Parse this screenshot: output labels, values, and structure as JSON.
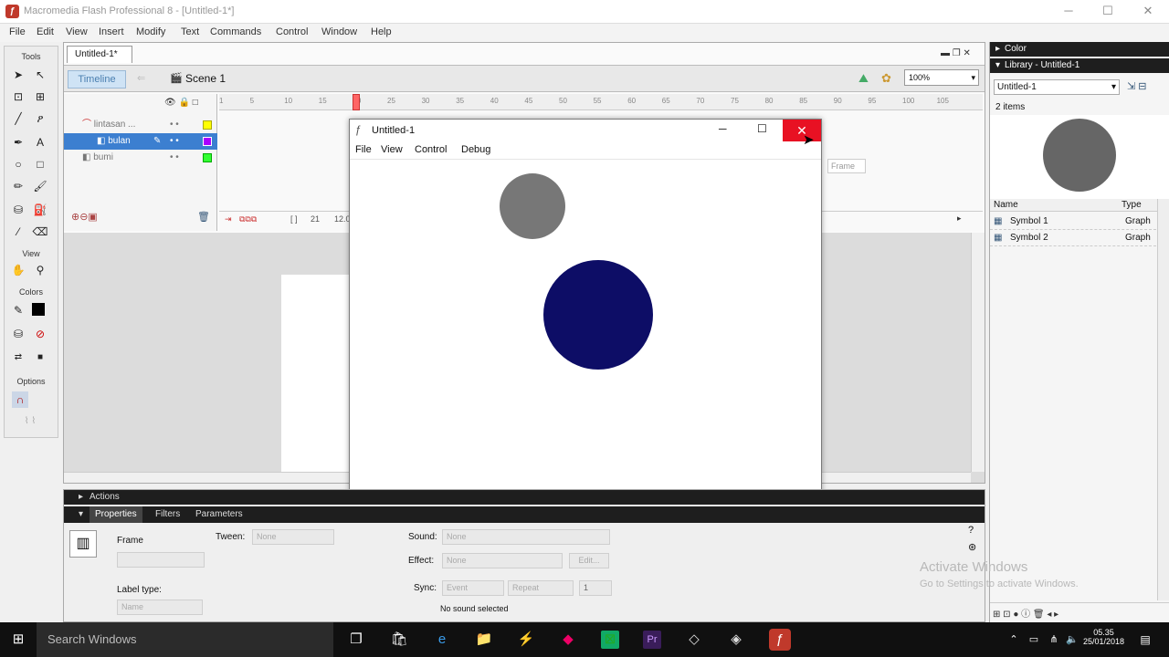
{
  "window": {
    "title": "Macromedia Flash Professional 8 - [Untitled-1*]",
    "minimize": "─",
    "maximize": "☐",
    "close": "✕"
  },
  "menu": [
    "File",
    "Edit",
    "View",
    "Insert",
    "Modify",
    "Text",
    "Commands",
    "Control",
    "Window",
    "Help"
  ],
  "tools": {
    "header": "Tools",
    "view_header": "View",
    "colors_header": "Colors",
    "options_header": "Options"
  },
  "document": {
    "tab": "Untitled-1*",
    "timeline_label": "Timeline",
    "scene": "Scene 1",
    "zoom": "100%",
    "layers": [
      "lintasan ...",
      "bulan",
      "bumi"
    ],
    "ruler": [
      "1",
      "5",
      "10",
      "15",
      "20",
      "25",
      "30",
      "35",
      "40",
      "45",
      "50",
      "55",
      "60",
      "65",
      "70",
      "75",
      "80",
      "85",
      "90",
      "95",
      "100",
      "105"
    ],
    "frame_number": "21",
    "fps": "12.0",
    "playhead_frame": 20
  },
  "player": {
    "title": "Untitled-1",
    "menu": [
      "File",
      "View",
      "Control",
      "Debug"
    ],
    "tooltip": "Frame",
    "moon_color": "#777777",
    "earth_color": "#0d0d66"
  },
  "right_panel": {
    "color_header": "Color",
    "library_header": "Library - Untitled-1",
    "library_select": "Untitled-1",
    "count": "2 items",
    "preview_color": "#666666",
    "col_name": "Name",
    "col_type": "Type",
    "items": [
      {
        "name": "Symbol 1",
        "type": "Graph"
      },
      {
        "name": "Symbol 2",
        "type": "Graph"
      }
    ]
  },
  "properties": {
    "actions_label": "Actions",
    "tabs": [
      "Properties",
      "Filters",
      "Parameters"
    ],
    "frame_label": "Frame",
    "label_type": "Label type:",
    "label_type_value": "Name",
    "tween_label": "Tween:",
    "tween_value": "None",
    "sound_label": "Sound:",
    "sound_value": "None",
    "effect_label": "Effect:",
    "effect_value": "None",
    "edit_label": "Edit...",
    "sync_label": "Sync:",
    "sync_value": "Event",
    "repeat_value": "Repeat",
    "repeat_count": "1",
    "no_sound": "No sound selected"
  },
  "watermark": {
    "line1": "Activate Windows",
    "line2": "Go to Settings to activate Windows."
  },
  "taskbar": {
    "search_placeholder": "Search Windows",
    "time": "05.35",
    "date": "25/01/2018"
  }
}
